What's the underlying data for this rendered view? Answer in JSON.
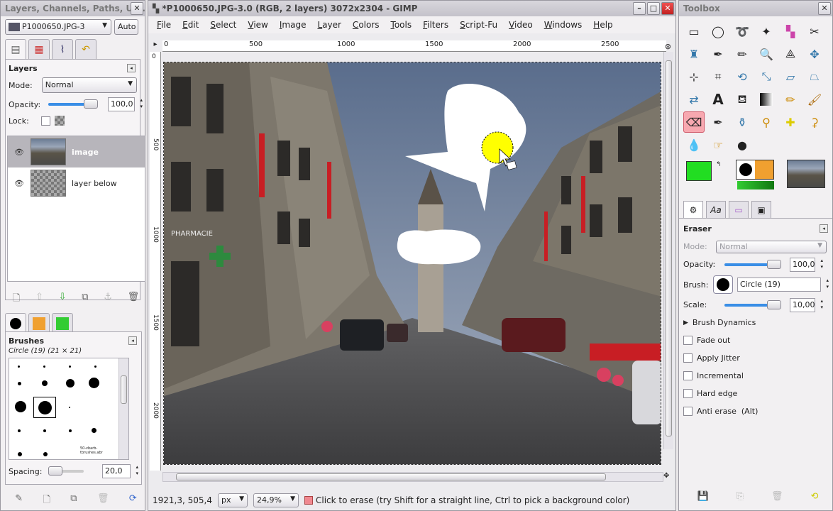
{
  "left_dock": {
    "title": "Layers, Channels, Paths, Un...",
    "image_selector": "P1000650.JPG-3",
    "auto_label": "Auto",
    "layers": {
      "title": "Layers",
      "mode_label": "Mode:",
      "mode_value": "Normal",
      "opacity_label": "Opacity:",
      "opacity_value": "100,0",
      "lock_label": "Lock:",
      "items": [
        {
          "name": "image",
          "selected": true
        },
        {
          "name": "layer below",
          "selected": false
        }
      ]
    },
    "brushes": {
      "title": "Brushes",
      "subtitle": "Circle (19) (21 × 21)",
      "spacing_label": "Spacing:",
      "spacing_value": "20,0",
      "brush_name_small": "50-vbarb-tbrushes.abr"
    }
  },
  "image_window": {
    "title": "*P1000650.JPG-3.0 (RGB, 2 layers) 3072x2304 - GIMP",
    "menu": [
      "File",
      "Edit",
      "Select",
      "View",
      "Image",
      "Layer",
      "Colors",
      "Tools",
      "Filters",
      "Script-Fu",
      "Video",
      "Windows",
      "Help"
    ],
    "ruler_h": [
      "0",
      "500",
      "1000",
      "1500",
      "2000",
      "2500"
    ],
    "ruler_v": [
      "0",
      "500",
      "1000",
      "1500",
      "2000"
    ],
    "canvas_text": "PHARMACIE",
    "status": {
      "coords": "1921,3, 505,4",
      "unit": "px",
      "zoom": "24,9%",
      "message": "Click to erase (try Shift for a straight line, Ctrl to pick a background color)"
    }
  },
  "toolbox": {
    "title": "Toolbox",
    "fg_color": "#22dd22",
    "bg_color": "#ffffff",
    "tool_options": {
      "title": "Eraser",
      "mode_label": "Mode:",
      "mode_value": "Normal",
      "opacity_label": "Opacity:",
      "opacity_value": "100,0",
      "brush_label": "Brush:",
      "brush_value": "Circle (19)",
      "scale_label": "Scale:",
      "scale_value": "10,00",
      "dynamics_label": "Brush Dynamics",
      "checks": [
        "Fade out",
        "Apply Jitter",
        "Incremental",
        "Hard edge",
        "Anti erase  (Alt)"
      ]
    }
  }
}
